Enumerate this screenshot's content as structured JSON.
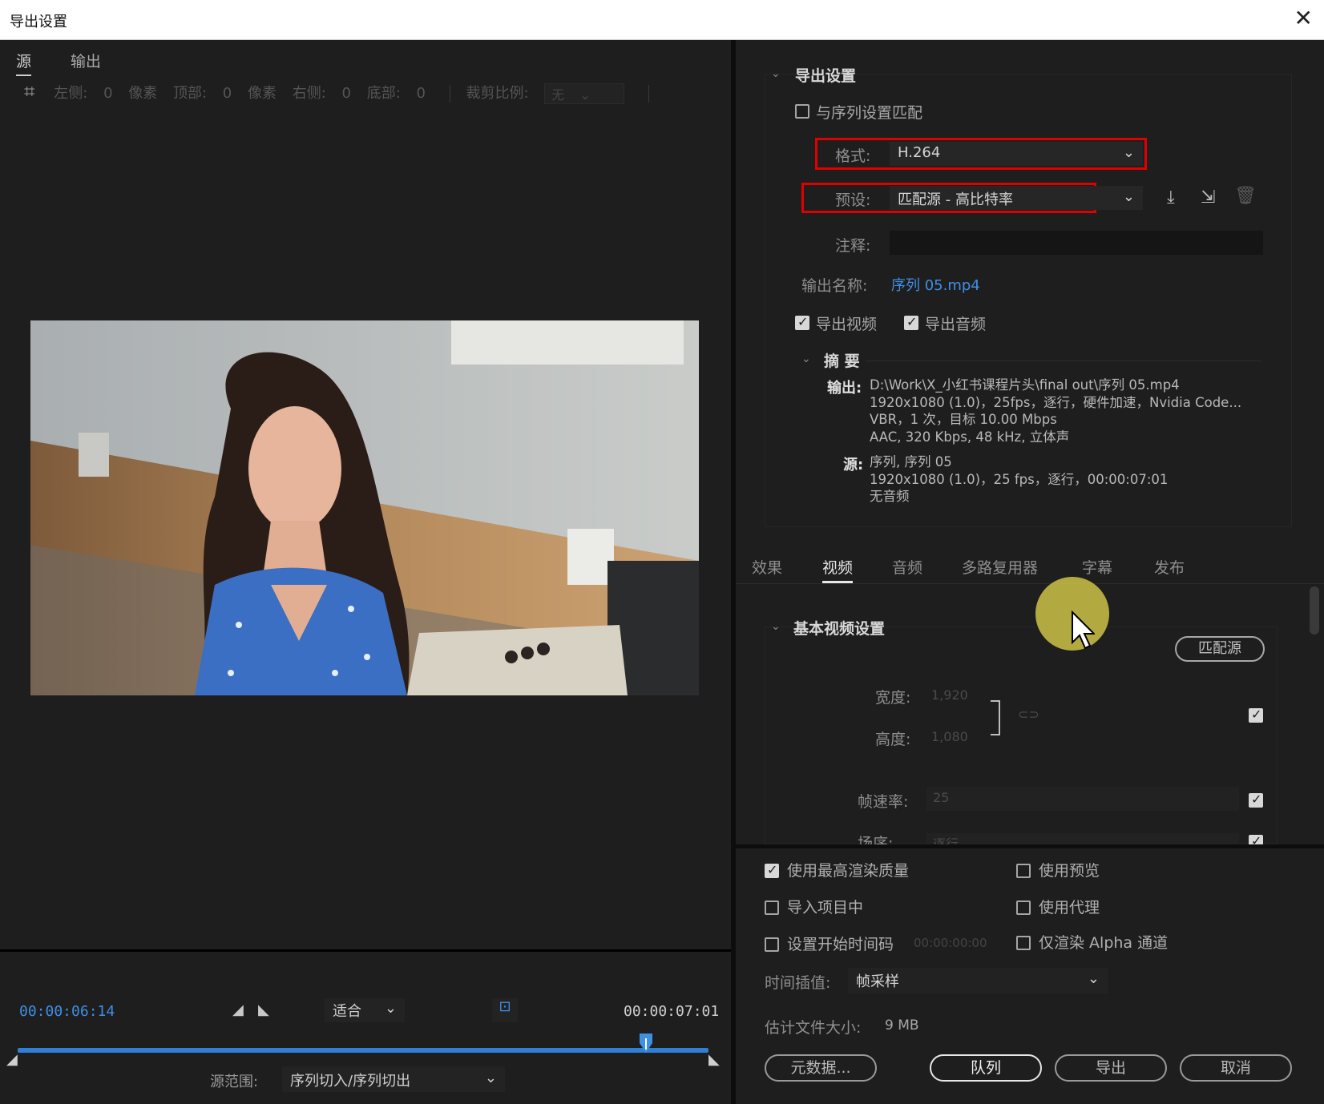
{
  "window": {
    "title": "导出设置",
    "close": "✕"
  },
  "left": {
    "tabs": [
      "源",
      "输出"
    ],
    "crop": {
      "left_label": "左侧:",
      "left_val": "0",
      "px1": "像素",
      "top_label": "顶部:",
      "top_val": "0",
      "px2": "像素",
      "right_label": "右侧:",
      "right_val": "0",
      "bottom_label": "底部:",
      "bottom_val": "0",
      "ratio_label": "裁剪比例:",
      "ratio_val": "无"
    },
    "timeline": {
      "current": "00:00:06:14",
      "end": "00:00:07:01",
      "fit": "适合",
      "range_label": "源范围:",
      "range_value": "序列切入/序列切出",
      "playhead_fraction": 0.91
    }
  },
  "export": {
    "section_title": "导出设置",
    "match_seq": "与序列设置匹配",
    "format_label": "格式:",
    "format_value": "H.264",
    "preset_label": "预设:",
    "preset_value": "匹配源 - 高比特率",
    "comment_label": "注释:",
    "comment_value": "",
    "outname_label": "输出名称:",
    "outname_value": "序列 05.mp4",
    "export_video": "导出视频",
    "export_audio": "导出音频",
    "summary_title": "摘 要",
    "summary": {
      "out_label": "输出:",
      "out_lines": [
        "D:\\Work\\X_小红书课程片头\\final out\\序列 05.mp4",
        "1920x1080 (1.0)，25fps，逐行，硬件加速，Nvidia Code...",
        "VBR，1 次，目标 10.00 Mbps",
        "AAC, 320 Kbps, 48  kHz, 立体声"
      ],
      "src_label": "源:",
      "src_lines": [
        "序列, 序列 05",
        "1920x1080 (1.0)，25 fps，逐行，00:00:07:01",
        "无音频"
      ]
    }
  },
  "tabs": [
    "效果",
    "视频",
    "音频",
    "多路复用器",
    "字幕",
    "发布"
  ],
  "video": {
    "section_title": "基本视频设置",
    "match_source": "匹配源",
    "width_label": "宽度:",
    "width_value": "1,920",
    "height_label": "高度:",
    "height_value": "1,080",
    "fps_label": "帧速率:",
    "fps_value": "25",
    "field_label": "场序:",
    "field_value": "逐行"
  },
  "options": {
    "max_quality": "使用最高渲染质量",
    "use_preview": "使用预览",
    "import_project": "导入项目中",
    "use_proxy": "使用代理",
    "set_start_tc": "设置开始时间码",
    "start_tc_value": "00:00:00:00",
    "alpha_only": "仅渲染 Alpha 通道",
    "interp_label": "时间插值:",
    "interp_value": "帧采样",
    "filesize_label": "估计文件大小:",
    "filesize_value": "9 MB"
  },
  "buttons": {
    "metadata": "元数据...",
    "queue": "队列",
    "export": "导出",
    "cancel": "取消"
  }
}
